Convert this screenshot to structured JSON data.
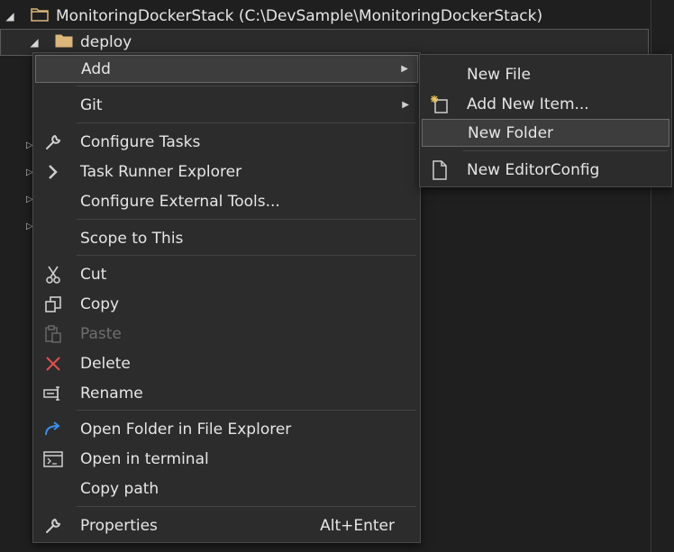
{
  "tree": {
    "root_label": "MonitoringDockerStack (C:\\DevSample\\MonitoringDockerStack)",
    "deploy_label": "deploy"
  },
  "context_menu": {
    "add": "Add",
    "git": "Git",
    "configure_tasks": "Configure Tasks",
    "task_runner_explorer": "Task Runner Explorer",
    "configure_external_tools": "Configure External Tools...",
    "scope_to_this": "Scope to This",
    "cut": "Cut",
    "copy": "Copy",
    "paste": "Paste",
    "delete": "Delete",
    "rename": "Rename",
    "open_folder_in_file_explorer": "Open Folder in File Explorer",
    "open_in_terminal": "Open in terminal",
    "copy_path": "Copy path",
    "properties": "Properties",
    "properties_shortcut": "Alt+Enter"
  },
  "add_submenu": {
    "new_file": "New File",
    "add_new_item": "Add New Item...",
    "new_folder": "New Folder",
    "new_editorconfig": "New EditorConfig"
  },
  "colors": {
    "background": "#1f1f1f",
    "menu_background": "#2c2c2c",
    "folder": "#dcb67a",
    "delete_icon": "#e05050",
    "accent_blue": "#3c8ee8"
  }
}
